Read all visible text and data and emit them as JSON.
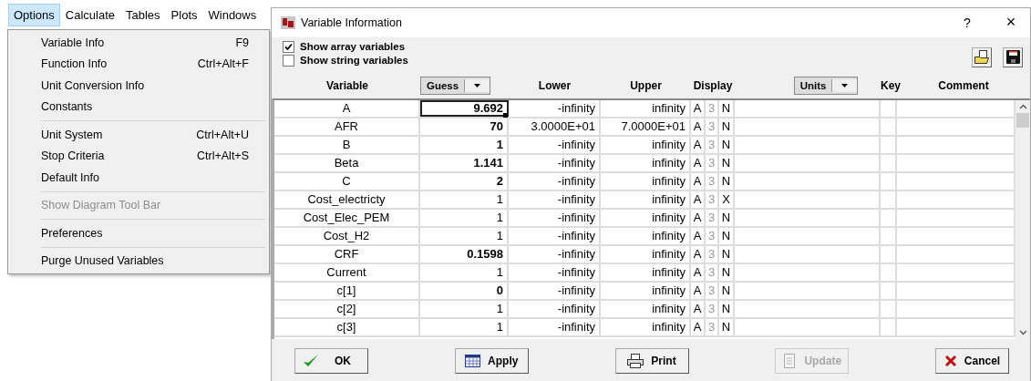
{
  "menubar": [
    {
      "label": "Options",
      "selected": true
    },
    {
      "label": "Calculate",
      "selected": false
    },
    {
      "label": "Tables",
      "selected": false
    },
    {
      "label": "Plots",
      "selected": false
    },
    {
      "label": "Windows",
      "selected": false
    }
  ],
  "menu": [
    {
      "kind": "item",
      "label": "Variable Info",
      "shortcut": "F9",
      "disabled": false
    },
    {
      "kind": "item",
      "label": "Function Info",
      "shortcut": "Ctrl+Alt+F",
      "disabled": false
    },
    {
      "kind": "item",
      "label": "Unit Conversion Info",
      "disabled": false
    },
    {
      "kind": "item",
      "label": "Constants",
      "disabled": false
    },
    {
      "kind": "separator"
    },
    {
      "kind": "item",
      "label": "Unit System",
      "shortcut": "Ctrl+Alt+U",
      "disabled": false
    },
    {
      "kind": "item",
      "label": "Stop Criteria",
      "shortcut": "Ctrl+Alt+S",
      "disabled": false
    },
    {
      "kind": "item",
      "label": "Default Info",
      "disabled": false
    },
    {
      "kind": "separator"
    },
    {
      "kind": "item",
      "label": "Show Diagram Tool Bar",
      "disabled": true
    },
    {
      "kind": "separator"
    },
    {
      "kind": "item",
      "label": "Preferences",
      "disabled": false
    },
    {
      "kind": "separator"
    },
    {
      "kind": "item",
      "label": "Purge Unused Variables",
      "disabled": false
    }
  ],
  "dialog": {
    "title": "Variable Information",
    "help": "?",
    "close": "×",
    "options": [
      {
        "label": "Show array variables",
        "checked": true
      },
      {
        "label": "Show string variables",
        "checked": false
      }
    ],
    "columns": [
      {
        "kind": "text",
        "label": "Variable"
      },
      {
        "kind": "dropdown",
        "label": "Guess"
      },
      {
        "kind": "text",
        "label": "Lower"
      },
      {
        "kind": "text",
        "label": "Upper"
      },
      {
        "kind": "text",
        "label": "Display"
      },
      {
        "kind": "dropdown",
        "label": "Units"
      },
      {
        "kind": "text",
        "label": "Key"
      },
      {
        "kind": "text",
        "label": "Comment"
      }
    ],
    "rows": [
      {
        "variable": "A",
        "guess": "9.692",
        "emphasized": true,
        "selected": true,
        "lower": "-infinity",
        "upper": "infinity",
        "display": [
          "A",
          "3",
          "N"
        ]
      },
      {
        "variable": "AFR",
        "guess": "70",
        "emphasized": true,
        "selected": false,
        "lower": "3.0000E+01",
        "upper": "7.0000E+01",
        "display": [
          "A",
          "3",
          "N"
        ]
      },
      {
        "variable": "B",
        "guess": "1",
        "emphasized": true,
        "selected": false,
        "lower": "-infinity",
        "upper": "infinity",
        "display": [
          "A",
          "3",
          "N"
        ]
      },
      {
        "variable": "Beta",
        "guess": "1.141",
        "emphasized": true,
        "selected": false,
        "lower": "-infinity",
        "upper": "infinity",
        "display": [
          "A",
          "3",
          "N"
        ]
      },
      {
        "variable": "C",
        "guess": "2",
        "emphasized": true,
        "selected": false,
        "lower": "-infinity",
        "upper": "infinity",
        "display": [
          "A",
          "3",
          "N"
        ]
      },
      {
        "variable": "Cost_electricty",
        "guess": "1",
        "emphasized": false,
        "selected": false,
        "lower": "-infinity",
        "upper": "infinity",
        "display": [
          "A",
          "3",
          "X"
        ]
      },
      {
        "variable": "Cost_Elec_PEM",
        "guess": "1",
        "emphasized": false,
        "selected": false,
        "lower": "-infinity",
        "upper": "infinity",
        "display": [
          "A",
          "3",
          "N"
        ]
      },
      {
        "variable": "Cost_H2",
        "guess": "1",
        "emphasized": false,
        "selected": false,
        "lower": "-infinity",
        "upper": "infinity",
        "display": [
          "A",
          "3",
          "N"
        ]
      },
      {
        "variable": "CRF",
        "guess": "0.1598",
        "emphasized": true,
        "selected": false,
        "lower": "-infinity",
        "upper": "infinity",
        "display": [
          "A",
          "3",
          "N"
        ]
      },
      {
        "variable": "Current",
        "guess": "1",
        "emphasized": false,
        "selected": false,
        "lower": "-infinity",
        "upper": "infinity",
        "display": [
          "A",
          "3",
          "N"
        ]
      },
      {
        "variable": "c[1]",
        "guess": "0",
        "emphasized": true,
        "selected": false,
        "lower": "-infinity",
        "upper": "infinity",
        "display": [
          "A",
          "3",
          "N"
        ]
      },
      {
        "variable": "c[2]",
        "guess": "1",
        "emphasized": false,
        "selected": false,
        "lower": "-infinity",
        "upper": "infinity",
        "display": [
          "A",
          "3",
          "N"
        ]
      },
      {
        "variable": "c[3]",
        "guess": "1",
        "emphasized": false,
        "selected": false,
        "lower": "-infinity",
        "upper": "infinity",
        "display": [
          "A",
          "3",
          "N"
        ]
      }
    ],
    "buttons": [
      {
        "kind": "ok",
        "label": "OK",
        "disabled": false
      },
      {
        "kind": "apply",
        "label": "Apply",
        "disabled": false
      },
      {
        "kind": "print",
        "label": "Print",
        "disabled": false
      },
      {
        "kind": "update",
        "label": "Update",
        "disabled": true
      },
      {
        "kind": "cancel",
        "label": "Cancel",
        "disabled": false
      }
    ]
  }
}
